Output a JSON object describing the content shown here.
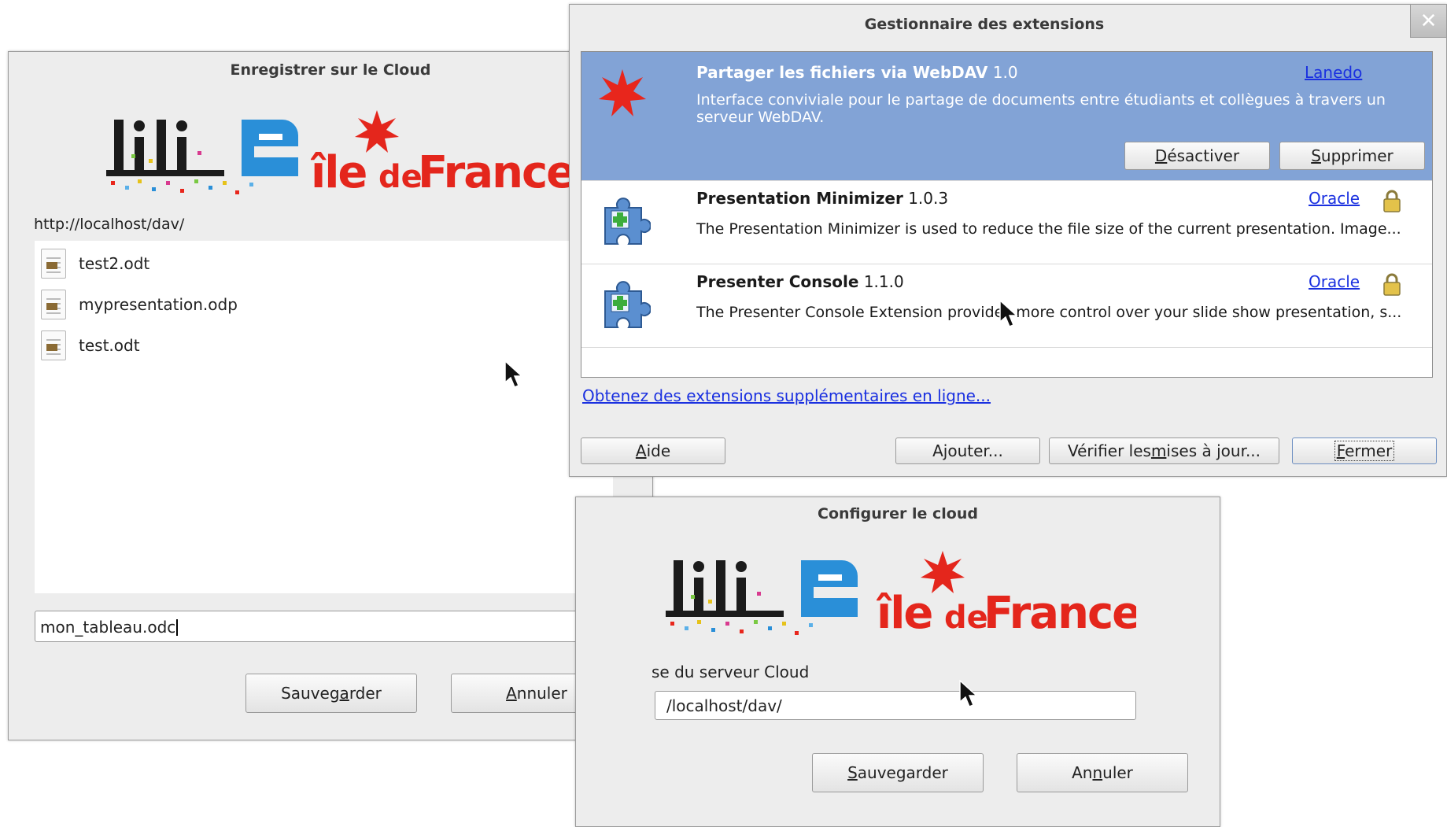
{
  "save_dialog": {
    "title": "Enregistrer sur le Cloud",
    "logo_left": "LiLiE",
    "logo_right": "îledeFrance",
    "path": "http://localhost/dav/",
    "files": [
      "test2.odt",
      "mypresentation.odp",
      "test.odt"
    ],
    "filename_value": "mon_tableau.odc",
    "save_button": {
      "mnemonic_before": "Sauveg",
      "mnemonic": "a",
      "mnemonic_after": "rder"
    },
    "cancel_button": {
      "mnemonic_before": "",
      "mnemonic": "A",
      "mnemonic_after": "nnuler"
    }
  },
  "config_dialog": {
    "title": "Configurer le cloud",
    "logo_left": "LiLiE",
    "logo_right": "îledeFrance",
    "server_label": "se du serveur Cloud",
    "server_value": "/localhost/dav/",
    "save_button": {
      "mnemonic_before": "",
      "mnemonic": "S",
      "mnemonic_after": "auvegarder"
    },
    "cancel_button": {
      "mnemonic_before": "An",
      "mnemonic": "n",
      "mnemonic_after": "uler"
    }
  },
  "extension_manager": {
    "title": "Gestionnaire des extensions",
    "close_glyph": "✕",
    "extensions": [
      {
        "name": "Partager les fichiers via WebDAV",
        "version": "1.0",
        "publisher": "Lanedo",
        "description": "Interface conviviale pour le partage de documents entre étudiants et collègues à travers un serveur WebDAV.",
        "selected": true,
        "icon": "red-star-icon",
        "disable_button": {
          "mnemonic_before": "",
          "mnemonic": "D",
          "mnemonic_after": "ésactiver"
        },
        "remove_button": {
          "mnemonic_before": "",
          "mnemonic": "S",
          "mnemonic_after": "upprimer"
        }
      },
      {
        "name": "Presentation Minimizer",
        "version": "1.0.3",
        "publisher": "Oracle",
        "description": "The Presentation Minimizer is used to reduce the file size of the current presentation. Image...",
        "locked": true,
        "icon": "puzzle-icon"
      },
      {
        "name": "Presenter Console",
        "version": "1.1.0",
        "publisher": "Oracle",
        "description": "The Presenter Console Extension provides more control over your slide show presentation, s...",
        "locked": true,
        "icon": "puzzle-icon"
      }
    ],
    "get_more_link": "Obtenez des extensions supplémentaires en ligne...",
    "help_button": {
      "mnemonic_before": "",
      "mnemonic": "A",
      "mnemonic_after": "ide"
    },
    "add_button": {
      "mnemonic_before": "A",
      "mnemonic": "j",
      "mnemonic_after": "outer..."
    },
    "update_button": {
      "mnemonic_before": "Vérifier les ",
      "mnemonic": "m",
      "mnemonic_after": "ises à jour..."
    },
    "close_button": {
      "mnemonic_before": "",
      "mnemonic": "F",
      "mnemonic_after": "ermer"
    }
  },
  "colors": {
    "selection": "#82a3d6",
    "link": "#1a30e0",
    "brand_red": "#e4261c",
    "brand_blue": "#2a8fd8"
  }
}
